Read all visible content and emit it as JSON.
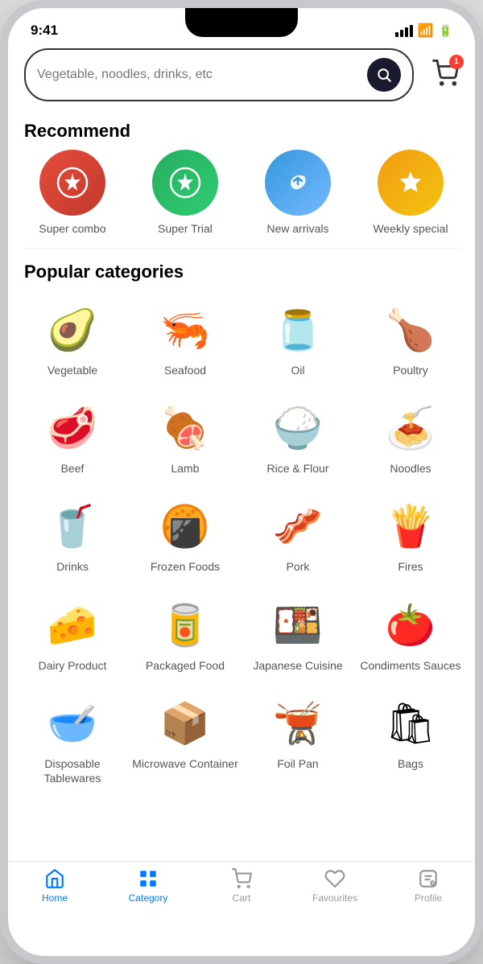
{
  "statusBar": {
    "time": "9:41",
    "batteryLevel": "100"
  },
  "search": {
    "placeholder": "Vegetable, noodles, drinks, etc",
    "cartCount": "1"
  },
  "sections": {
    "recommend": {
      "title": "Recommend",
      "items": [
        {
          "label": "Super combo",
          "colorClass": "circle-red",
          "icon": "S"
        },
        {
          "label": "Super Trial",
          "colorClass": "circle-green",
          "icon": "S"
        },
        {
          "label": "New arrivals",
          "colorClass": "circle-blue",
          "icon": "↩"
        },
        {
          "label": "Weekly special",
          "colorClass": "circle-yellow",
          "icon": "★"
        }
      ]
    },
    "categories": {
      "title": "Popular categories",
      "items": [
        {
          "label": "Vegetable",
          "emoji": "🥑"
        },
        {
          "label": "Seafood",
          "emoji": "🦐"
        },
        {
          "label": "Oil",
          "emoji": "🫙"
        },
        {
          "label": "Poultry",
          "emoji": "🍗"
        },
        {
          "label": "Beef",
          "emoji": "🥩"
        },
        {
          "label": "Lamb",
          "emoji": "🍖"
        },
        {
          "label": "Rice & Flour",
          "emoji": "🍚"
        },
        {
          "label": "Noodles",
          "emoji": "🍝"
        },
        {
          "label": "Drinks",
          "emoji": "🥤"
        },
        {
          "label": "Frozen Foods",
          "emoji": "🍘"
        },
        {
          "label": "Pork",
          "emoji": "🥓"
        },
        {
          "label": "Fires",
          "emoji": "🍟"
        },
        {
          "label": "Dairy Product",
          "emoji": "🧀"
        },
        {
          "label": "Packaged Food",
          "emoji": "🥫"
        },
        {
          "label": "Japanese Cuisine",
          "emoji": "🍱"
        },
        {
          "label": "Condiments Sauces",
          "emoji": "🍅"
        },
        {
          "label": "Disposable Tablewares",
          "emoji": "🥣"
        },
        {
          "label": "Microwave Container",
          "emoji": "📦"
        },
        {
          "label": "Foil Pan",
          "emoji": "🫕"
        },
        {
          "label": "Bags",
          "emoji": "🛍"
        }
      ]
    }
  },
  "bottomNav": {
    "items": [
      {
        "label": "Home",
        "icon": "🏠",
        "active": true
      },
      {
        "label": "Category",
        "icon": "▦",
        "active": false
      },
      {
        "label": "Cart",
        "icon": "🛒",
        "active": false
      },
      {
        "label": "Favourites",
        "icon": "♡",
        "active": false
      },
      {
        "label": "Profile",
        "icon": "👤",
        "active": false
      }
    ]
  }
}
